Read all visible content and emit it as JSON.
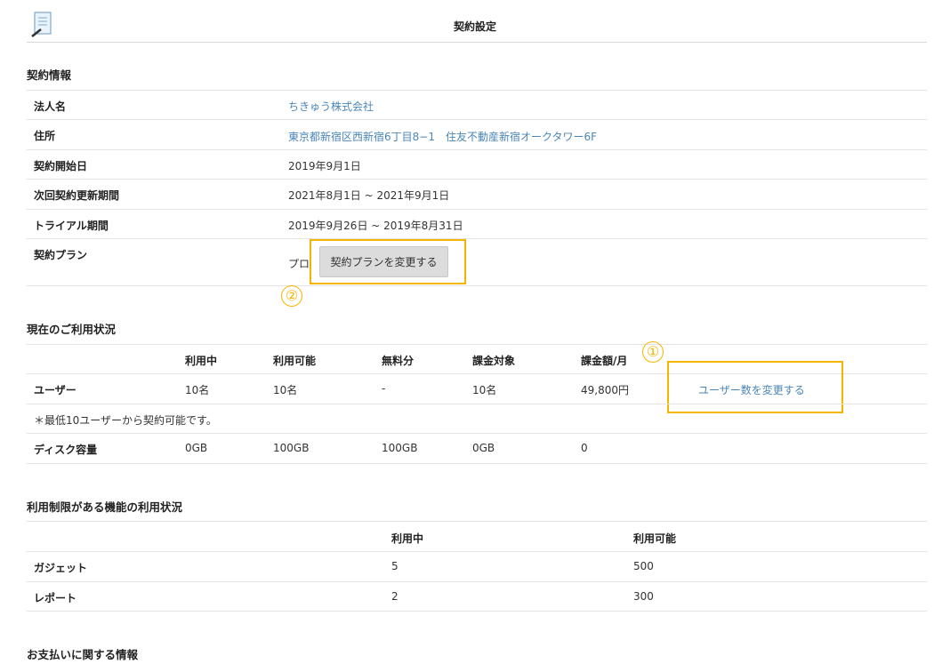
{
  "header": {
    "title": "契約設定",
    "icon": "document-pen-icon"
  },
  "contract_info": {
    "section_title": "契約情報",
    "rows": [
      {
        "label": "法人名",
        "value": "ちきゅう株式会社"
      },
      {
        "label": "住所",
        "value": "東京都新宿区西新宿6丁目8−1　住友不動産新宿オークタワー6F"
      },
      {
        "label": "契約開始日",
        "value": "2019年9月1日"
      },
      {
        "label": "次回契約更新期間",
        "value": "2021年8月1日 ~ 2021年9月1日"
      },
      {
        "label": "トライアル期間",
        "value": "2019年9月26日 ~ 2019年8月31日"
      }
    ],
    "plan": {
      "label": "契約プラン",
      "value": "プロ",
      "change_button": "契約プランを変更する"
    }
  },
  "usage": {
    "section_title": "現在のご利用状況",
    "headers": [
      "利用中",
      "利用可能",
      "無料分",
      "課金対象",
      "課金額/月"
    ],
    "user_row": {
      "label": "ユーザー",
      "values": [
        "10名",
        "10名",
        "-",
        "10名",
        "49,800円"
      ],
      "action": "ユーザー数を変更する"
    },
    "note": "＊最低10ユーザーから契約可能です。",
    "disk_row": {
      "label": "ディスク容量",
      "values": [
        "0GB",
        "100GB",
        "100GB",
        "0GB",
        "0"
      ]
    }
  },
  "limits": {
    "section_title": "利用制限がある機能の利用状況",
    "headers": [
      "利用中",
      "利用可能"
    ],
    "rows": [
      {
        "label": "ガジェット",
        "in_use": "5",
        "available": "500"
      },
      {
        "label": "レポート",
        "in_use": "2",
        "available": "300"
      }
    ]
  },
  "payment": {
    "section_title": "お支払いに関する情報"
  },
  "annotations": {
    "marker_1": "①",
    "marker_2": "②",
    "highlight_color": "#f4b400"
  }
}
